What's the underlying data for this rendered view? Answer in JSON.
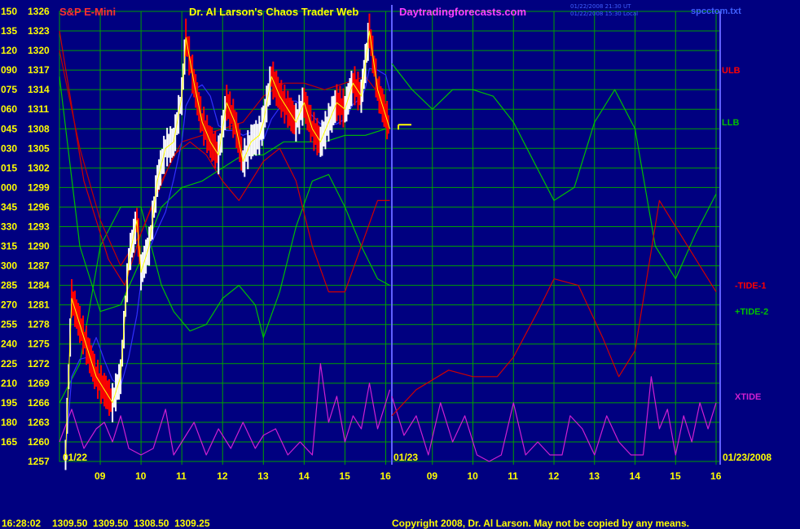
{
  "header": {
    "instrument": "S&P E-Mini",
    "title": "Dr. Al Larson's Chaos Trader Web",
    "website": "Daytradingforecasts.com",
    "timestamp_ut": "01/22/2008 21:30 UT",
    "timestamp_local": "01/22/2008 15:30 Local",
    "filename": "spcctom.txt"
  },
  "footer": {
    "quote_time": "16:28:02",
    "quote_values": "1309.50  1309.50  1308.50  1309.25",
    "copyright": "Copyright 2008, Dr. Al Larson. May not be copied by any means."
  },
  "colors": {
    "background": "#000080",
    "grid": "#00a000",
    "price_bar": "#ffffff",
    "down_bar": "#ff0000",
    "ulb": "#c00000",
    "llb": "#00c000",
    "tide1": "#d00000",
    "tide2": "#00c000",
    "xtide": "#d020d0",
    "ma": "#3030ff",
    "axis_label": "#ffff00",
    "title": "#ffff00",
    "instrument": "#ff3030",
    "website": "#ff40ff",
    "divider": "#6060ff"
  },
  "chart_data": {
    "type": "line",
    "y_axis": {
      "left_labels": [
        "150",
        "135",
        "120",
        "090",
        "075",
        "060",
        "045",
        "030",
        "015",
        "000",
        "345",
        "330",
        "315",
        "300",
        "285",
        "270",
        "255",
        "240",
        "225",
        "210",
        "195",
        "180",
        "165"
      ],
      "price_labels": [
        "1326",
        "1323",
        "1320",
        "1317",
        "1314",
        "1311",
        "1308",
        "1305",
        "1302",
        "1299",
        "1296",
        "1293",
        "1290",
        "1287",
        "1284",
        "1281",
        "1278",
        "1275",
        "1272",
        "1269",
        "1266",
        "1263",
        "1260",
        "1257"
      ],
      "price_range": [
        1257,
        1326
      ]
    },
    "x_axis": {
      "hour_labels": [
        "09",
        "10",
        "11",
        "12",
        "13",
        "14",
        "15",
        "16",
        "09",
        "10",
        "11",
        "12",
        "13",
        "14",
        "15",
        "16"
      ],
      "date_labels": [
        "01/22",
        "01/23",
        "01/23/2008"
      ]
    },
    "right_labels": [
      "ULB",
      "LLB",
      "-TIDE-1",
      "+TIDE-2",
      "XTIDE"
    ],
    "price_series": {
      "name": "S&P E-Mini",
      "hours": [
        8.15,
        8.3,
        8.5,
        8.7,
        8.9,
        9.1,
        9.3,
        9.5,
        9.7,
        9.9,
        10.0,
        10.2,
        10.4,
        10.6,
        10.8,
        11.0,
        11.1,
        11.3,
        11.5,
        11.7,
        11.9,
        12.1,
        12.3,
        12.5,
        12.7,
        12.9,
        13.0,
        13.2,
        13.4,
        13.6,
        13.8,
        14.0,
        14.2,
        14.4,
        14.6,
        14.8,
        15.0,
        15.2,
        15.4,
        15.5,
        15.6,
        15.8,
        16.0,
        16.1
      ],
      "values": [
        1258,
        1282,
        1278,
        1274,
        1270,
        1268,
        1266,
        1270,
        1288,
        1294,
        1286,
        1290,
        1300,
        1305,
        1306,
        1313,
        1322,
        1315,
        1309,
        1306,
        1304,
        1312,
        1309,
        1303,
        1306,
        1307,
        1309,
        1316,
        1313,
        1311,
        1309,
        1312,
        1308,
        1306,
        1309,
        1312,
        1311,
        1315,
        1313,
        1318,
        1323,
        1314,
        1310,
        1308
      ]
    },
    "ulb": {
      "hours": [
        8.0,
        8.5,
        9.0,
        9.5,
        10.0,
        10.5,
        11.0,
        11.5,
        12.0,
        12.5,
        13.0,
        13.5,
        14.0,
        14.5,
        15.0,
        15.5,
        16.0
      ],
      "values": [
        1320,
        1305,
        1294,
        1287,
        1292,
        1300,
        1306,
        1307,
        1308,
        1309,
        1313,
        1315,
        1315,
        1314,
        1315,
        1316,
        1312
      ]
    },
    "llb": {
      "hours": [
        8.0,
        8.5,
        9.0,
        9.5,
        10.0,
        10.5,
        11.0,
        11.5,
        12.0,
        12.5,
        13.0,
        13.5,
        14.0,
        14.5,
        15.0,
        15.5,
        16.0
      ],
      "values": [
        1316,
        1290,
        1280,
        1281,
        1288,
        1296,
        1299,
        1300,
        1302,
        1304,
        1304,
        1306,
        1306,
        1306,
        1307,
        1307,
        1308
      ]
    },
    "tide1_day1": {
      "hours": [
        8.0,
        8.6,
        9.2,
        9.6,
        10.0,
        10.4,
        10.8,
        11.2,
        11.6,
        12.0,
        12.4,
        12.8,
        13.0,
        13.4,
        13.8,
        14.2,
        14.6,
        15.0,
        15.4,
        15.8,
        16.1
      ],
      "values": [
        1323,
        1300,
        1288,
        1284,
        1292,
        1298,
        1304,
        1306,
        1304,
        1300,
        1297,
        1301,
        1303,
        1305,
        1300,
        1290,
        1283,
        1283,
        1290,
        1297,
        1297
      ]
    },
    "tide1_day2": {
      "hours": [
        8.0,
        8.6,
        9.4,
        10.0,
        10.6,
        11.0,
        11.6,
        12.0,
        12.6,
        13.2,
        13.6,
        14.0,
        14.6,
        15.0,
        15.6,
        16.0
      ],
      "values": [
        1264,
        1268,
        1271,
        1270,
        1270,
        1273,
        1280,
        1285,
        1284,
        1276,
        1270,
        1274,
        1297,
        1293,
        1287,
        1283
      ]
    },
    "tide2_day1": {
      "hours": [
        8.0,
        8.5,
        9.0,
        9.5,
        10.0,
        10.5,
        10.8,
        11.2,
        11.6,
        12.0,
        12.4,
        12.8,
        13.0,
        13.4,
        13.8,
        14.2,
        14.6,
        15.0,
        15.4,
        15.8,
        16.1
      ],
      "values": [
        1266,
        1272,
        1290,
        1296,
        1296,
        1284,
        1280,
        1277,
        1278,
        1282,
        1284,
        1281,
        1276,
        1283,
        1293,
        1300,
        1301,
        1296,
        1290,
        1285,
        1284
      ]
    },
    "tide2_day2": {
      "hours": [
        8.0,
        8.5,
        9.0,
        9.5,
        10.0,
        10.5,
        11.0,
        11.5,
        12.0,
        12.5,
        13.0,
        13.5,
        14.0,
        14.5,
        15.0,
        15.5,
        16.0
      ],
      "values": [
        1318,
        1314,
        1311,
        1314,
        1314,
        1313,
        1309,
        1303,
        1297,
        1299,
        1309,
        1314,
        1308,
        1290,
        1285,
        1292,
        1298
      ]
    },
    "xtide": {
      "hours": [
        8.0,
        8.3,
        8.6,
        8.9,
        9.1,
        9.3,
        9.5,
        9.7,
        10.0,
        10.3,
        10.6,
        10.8,
        11.0,
        11.3,
        11.6,
        11.9,
        12.2,
        12.5,
        12.8,
        13.0,
        13.3,
        13.6,
        13.9,
        14.2,
        14.4,
        14.6,
        14.8,
        15.0,
        15.2,
        15.4,
        15.6,
        15.8,
        16.0,
        16.1
      ],
      "values": [
        1260,
        1265,
        1259,
        1262,
        1263,
        1260,
        1264,
        1259,
        1258,
        1259,
        1265,
        1258,
        1260,
        1263,
        1258,
        1262,
        1259,
        1263,
        1259,
        1261,
        1262,
        1258,
        1260,
        1258,
        1272,
        1263,
        1267,
        1260,
        1264,
        1262,
        1269,
        1262,
        1266,
        1268
      ],
      "day2_hours": [
        8.0,
        8.3,
        8.6,
        8.9,
        9.2,
        9.5,
        9.8,
        10.1,
        10.4,
        10.7,
        11.0,
        11.3,
        11.6,
        11.9,
        12.2,
        12.4,
        12.7,
        13.0,
        13.3,
        13.6,
        13.9,
        14.2,
        14.4,
        14.6,
        14.8,
        15.0,
        15.2,
        15.4,
        15.6,
        15.8,
        16.0
      ],
      "day2_values": [
        1267,
        1261,
        1264,
        1258,
        1266,
        1260,
        1264,
        1258,
        1257,
        1258,
        1266,
        1258,
        1260,
        1258,
        1258,
        1264,
        1262,
        1258,
        1264,
        1260,
        1258,
        1258,
        1270,
        1262,
        1265,
        1258,
        1264,
        1260,
        1266,
        1262,
        1266
      ]
    }
  }
}
